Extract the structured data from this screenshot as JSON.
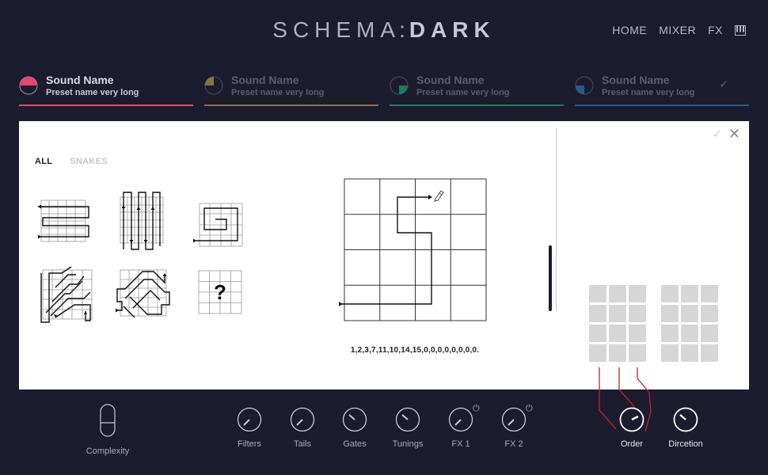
{
  "app": {
    "logo_light": "SCHEMA",
    "logo_colon": ":",
    "logo_bold": "DARK"
  },
  "nav": {
    "home": "HOME",
    "mixer": "MIXER",
    "fx": "FX",
    "keys_icon": "piano-keys-icon"
  },
  "slots": [
    {
      "name": "Sound Name",
      "preset": "Preset name very long",
      "color": "#e8466a",
      "active": true
    },
    {
      "name": "Sound Name",
      "preset": "Preset name very long",
      "color": "#8a7444",
      "active": false
    },
    {
      "name": "Sound Name",
      "preset": "Preset name very long",
      "color": "#1e7a62",
      "active": false
    },
    {
      "name": "Sound Name",
      "preset": "Preset name very long",
      "color": "#2a5a85",
      "active": false,
      "check": "✓"
    }
  ],
  "pattern_panel": {
    "filter_all": "ALL",
    "filter_snakes": "SNAKES",
    "sequence": "1,2,3,7,11,10,14,15,0,0,0,0,0,0,0,0.",
    "confirm_icon": "✓",
    "close_icon": "✕",
    "edit_icon": "pencil-icon",
    "random_symbol": "?"
  },
  "controls": {
    "complexity": "Complexity",
    "knobs": [
      {
        "label": "Filters",
        "power": false
      },
      {
        "label": "Tails",
        "power": false
      },
      {
        "label": "Gates",
        "power": false
      },
      {
        "label": "Tunings",
        "power": false
      },
      {
        "label": "FX 1",
        "power": true
      },
      {
        "label": "FX 2",
        "power": true
      },
      {
        "label": "Order",
        "power": false,
        "active": true
      },
      {
        "label": "Dircetion",
        "power": false,
        "active": true
      }
    ],
    "power_symbol": "⏻"
  },
  "colors": {
    "background": "#1b1c2e",
    "accent_red": "#e8466a",
    "wire_red": "#c0262e",
    "panel": "#ffffff"
  }
}
